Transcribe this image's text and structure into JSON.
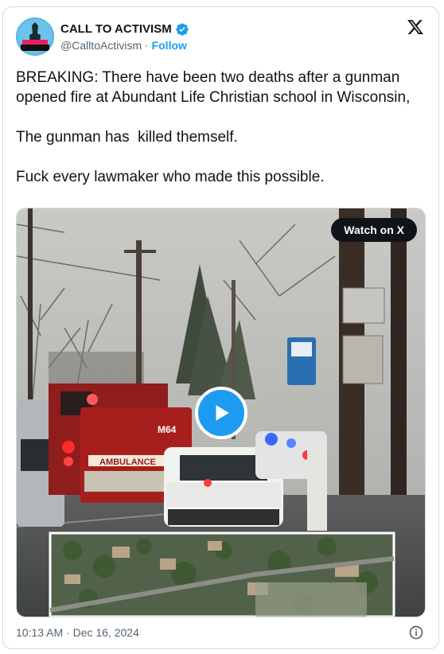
{
  "author": {
    "name": "CALL TO ACTIVISM",
    "handle": "@CalltoActivism",
    "separator": "·",
    "follow_label": "Follow"
  },
  "tweet": {
    "text": "BREAKING: There have been two deaths after a gunman opened fire at Abundant Life Christian school in Wisconsin,\n\nThe gunman has  killed themself.\n\nFuck every lawmaker who made this possible."
  },
  "media": {
    "watch_label": "Watch on X",
    "ambulance_unit": "M64",
    "ambulance_text": "AMBULANCE"
  },
  "footer": {
    "timestamp": "10:13 AM · Dec 16, 2024"
  },
  "colors": {
    "accent": "#1d9bf0",
    "text": "#0f1419",
    "muted": "#536471",
    "border": "#cfd9de"
  },
  "icons": {
    "verified": "verified-badge-icon",
    "x_logo": "x-logo-icon",
    "play": "play-icon",
    "info": "info-icon"
  }
}
